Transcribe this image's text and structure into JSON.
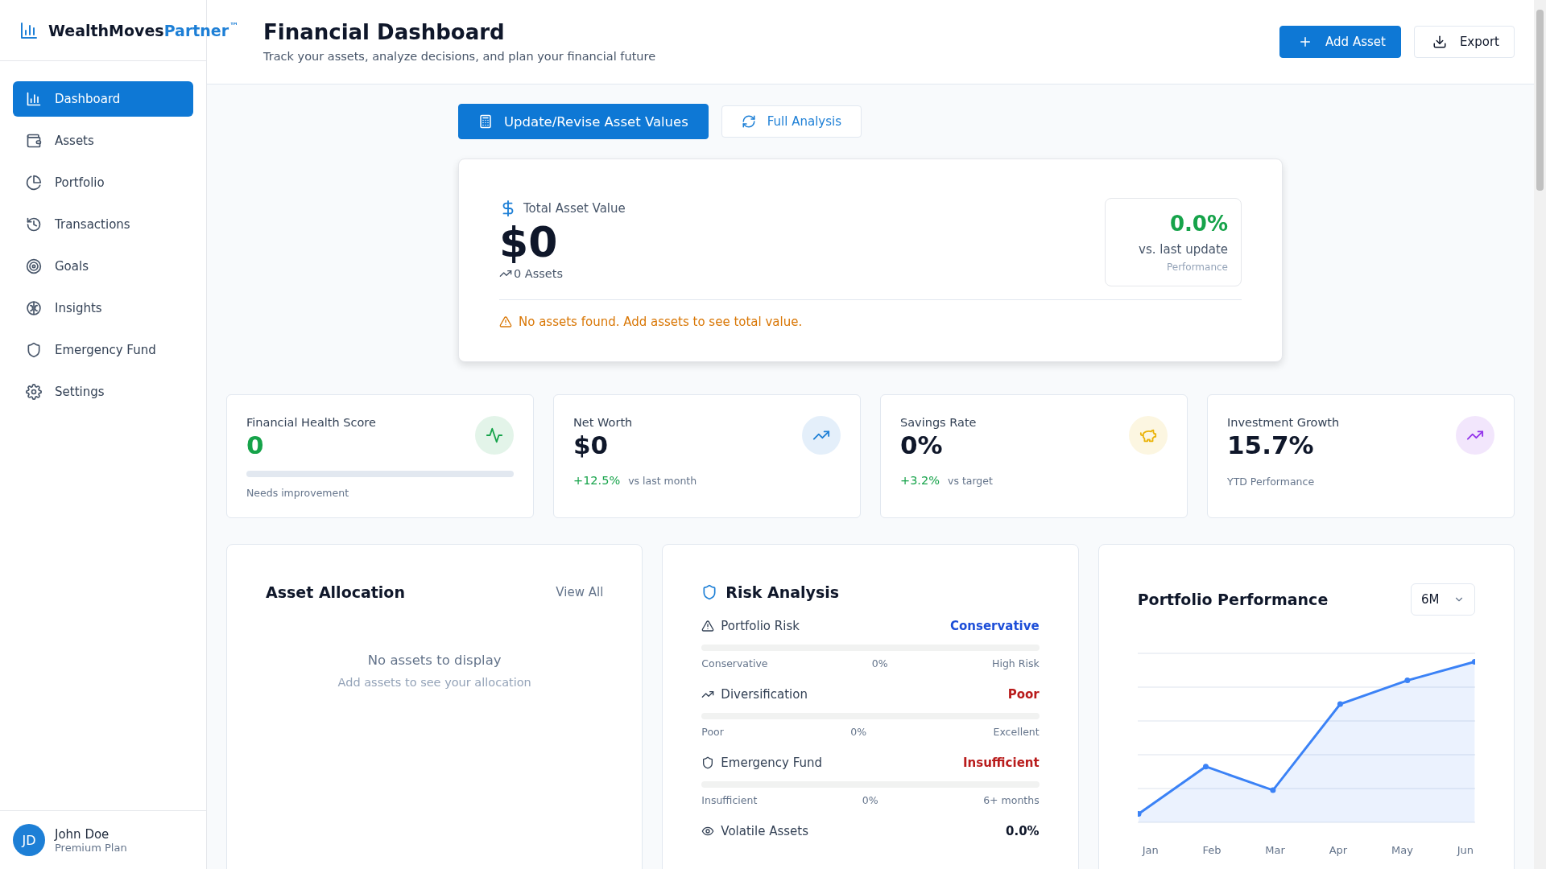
{
  "sidebar": {
    "brand": {
      "name": "WealthMoves",
      "accent": "Partner",
      "mark": "™"
    },
    "items": [
      {
        "label": "Dashboard",
        "selected": true
      },
      {
        "label": "Assets",
        "selected": false
      },
      {
        "label": "Portfolio",
        "selected": false
      },
      {
        "label": "Transactions",
        "selected": false
      },
      {
        "label": "Goals",
        "selected": false
      },
      {
        "label": "Insights",
        "selected": false
      },
      {
        "label": "Emergency Fund",
        "selected": false
      },
      {
        "label": "Settings",
        "selected": false
      }
    ],
    "user": {
      "initials": "JD",
      "name": "John Doe",
      "plan": "Premium Plan"
    }
  },
  "header": {
    "title": "Financial Dashboard",
    "subtitle": "Track your assets, analyze decisions, and plan your financial future",
    "buttons": [
      {
        "label": "Add Asset",
        "primary": true
      },
      {
        "label": "Export",
        "primary": false
      }
    ]
  },
  "actions": [
    {
      "label": "Update/Revise Asset Values",
      "primary": true
    },
    {
      "label": "Full Analysis",
      "primary": false
    }
  ],
  "total_card": {
    "label": "Total Asset Value",
    "value": "$0",
    "count": "0 Assets",
    "change": "0.0%",
    "change_label": "vs. last update",
    "change_caption": "Performance",
    "warning": "No assets found. Add assets to see total value."
  },
  "stats": [
    {
      "kind": "meter",
      "label": "Financial Health Score",
      "value": "0",
      "color": "#16a34a",
      "level": 0,
      "caption": "Needs improvement"
    },
    {
      "kind": "change",
      "label": "Net Worth",
      "value": "$0",
      "color": "#1d7fd6",
      "change": "+12.5%",
      "caption": "vs last month"
    },
    {
      "kind": "change",
      "label": "Savings Rate",
      "value": "0%",
      "color": "#eab308",
      "change": "+3.2%",
      "caption": "vs target"
    },
    {
      "kind": "note",
      "label": "Investment Growth",
      "value": "15.7%",
      "color": "#9333ea",
      "caption": "YTD Performance"
    }
  ],
  "allocation": {
    "title": "Asset Allocation",
    "link": "View All",
    "empty_title": "No assets to display",
    "empty_hint": "Add assets to see your allocation"
  },
  "risk": {
    "title": "Risk Analysis",
    "rows": [
      {
        "kind": "meter",
        "label": "Portfolio Risk",
        "status": "Conservative",
        "color": "#1d4ed8",
        "level": 0,
        "low": "Conservative",
        "mid": "0%",
        "high": "High Risk"
      },
      {
        "kind": "meter",
        "label": "Diversification",
        "status": "Poor",
        "color": "#b91c1c",
        "level": 0,
        "low": "Poor",
        "mid": "0%",
        "high": "Excellent"
      },
      {
        "kind": "meter",
        "label": "Emergency Fund",
        "status": "Insufficient",
        "color": "#b91c1c",
        "level": 0,
        "low": "Insufficient",
        "mid": "0%",
        "high": "6+ months"
      },
      {
        "kind": "value",
        "label": "Volatile Assets",
        "status": "0.0%",
        "color": "#0f172a"
      }
    ]
  },
  "performance": {
    "title": "Portfolio Performance",
    "range": "6M",
    "x_labels": [
      "Jan",
      "Feb",
      "Mar",
      "Apr",
      "May",
      "Jun"
    ]
  }
}
